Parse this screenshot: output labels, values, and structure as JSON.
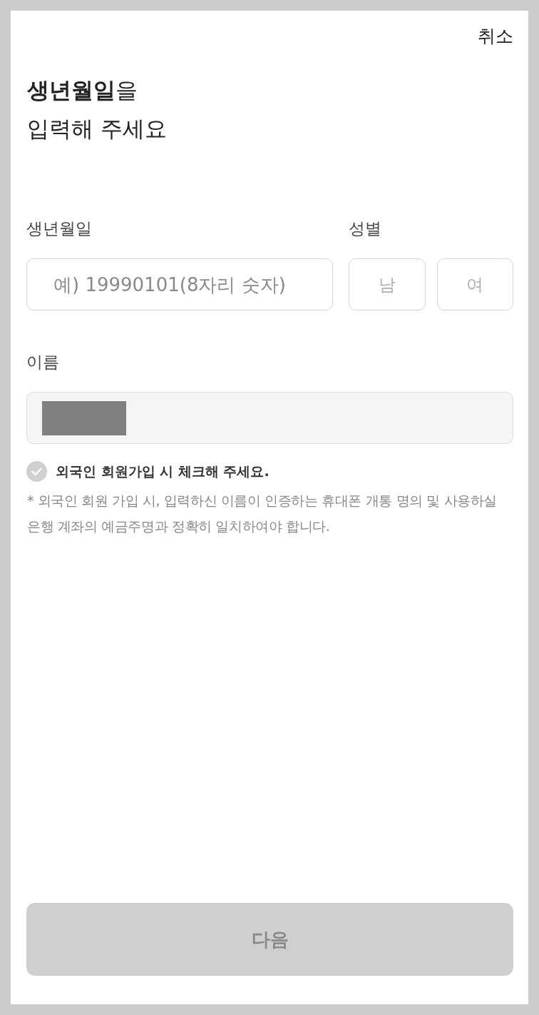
{
  "header": {
    "cancel": "취소"
  },
  "title": "**생년월일**을\n입력해 주세요",
  "birth": {
    "label": "생년월일",
    "placeholder": "예) 19990101(8자리 숫자)"
  },
  "gender": {
    "label": "성별",
    "options": [
      {
        "label": "남",
        "selected": false
      },
      {
        "label": "여",
        "selected": false
      }
    ]
  },
  "name": {
    "label": "이름",
    "redacted": true
  },
  "foreigner_check": {
    "label": "외국인 회원가입 시 체크해 주세요.",
    "checked": false
  },
  "notice": "* 외국인 회원 가입 시, 입력하신 이름이 인증하는 휴대폰 개통 명의 및 사용하실 은행 계좌의 예금주명과 정확히 일치하여야 합니다.",
  "next_button": {
    "label": "다음",
    "disabled": true
  }
}
